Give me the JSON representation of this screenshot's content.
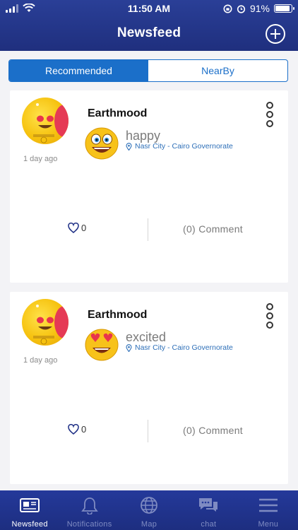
{
  "status_bar": {
    "time": "11:50 AM",
    "battery": "91%",
    "battery_level": 0.91
  },
  "header": {
    "title": "Newsfeed"
  },
  "segment": {
    "tabs": [
      "Recommended",
      "NearBy"
    ],
    "active_index": 0
  },
  "posts": [
    {
      "username": "Earthmood",
      "mood": "happy",
      "location": "Nasr City - Cairo Governorate",
      "time_ago": "1 day ago",
      "likes": "0",
      "comment_label": "(0) Comment"
    },
    {
      "username": "Earthmood",
      "mood": "excited",
      "location": "Nasr City - Cairo Governorate",
      "time_ago": "1 day ago",
      "likes": "0",
      "comment_label": "(0) Comment"
    }
  ],
  "tabbar": {
    "items": [
      {
        "label": "Newsfeed",
        "icon": "newspaper-icon",
        "active": true
      },
      {
        "label": "Notifications",
        "icon": "bell-icon",
        "active": false
      },
      {
        "label": "Map",
        "icon": "globe-icon",
        "active": false
      },
      {
        "label": "chat",
        "icon": "chat-bubbles-icon",
        "active": false
      },
      {
        "label": "Menu",
        "icon": "hamburger-icon",
        "active": false
      }
    ]
  },
  "colors": {
    "header": "#2a3f97",
    "accent": "#1b6fc9",
    "tabbar": "#24399a",
    "link": "#2d6fb8"
  }
}
